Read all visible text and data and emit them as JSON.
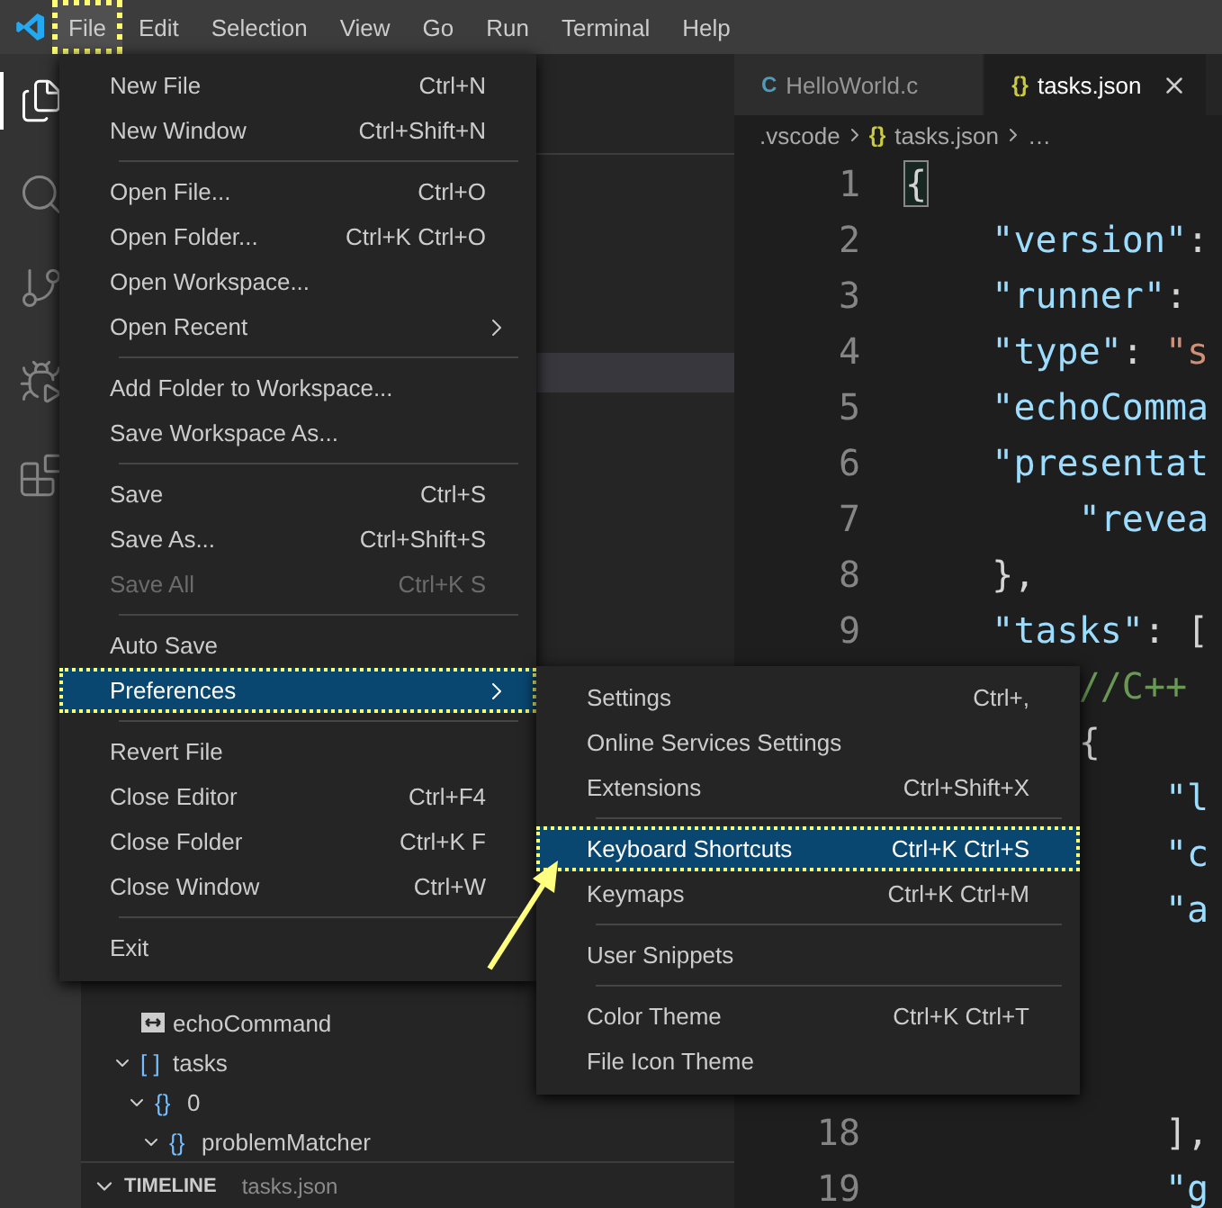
{
  "menubar": {
    "items": [
      {
        "label": "File",
        "selected": true
      },
      {
        "label": "Edit",
        "selected": false
      },
      {
        "label": "Selection",
        "selected": false
      },
      {
        "label": "View",
        "selected": false
      },
      {
        "label": "Go",
        "selected": false
      },
      {
        "label": "Run",
        "selected": false
      },
      {
        "label": "Terminal",
        "selected": false
      },
      {
        "label": "Help",
        "selected": false
      }
    ]
  },
  "activity_bar": [
    {
      "kind": "explorer",
      "selected": true
    },
    {
      "kind": "search",
      "selected": false
    },
    {
      "kind": "source-control",
      "selected": false
    },
    {
      "kind": "run",
      "selected": false
    },
    {
      "kind": "extensions",
      "selected": false
    }
  ],
  "sidebar": {
    "outline": [
      {
        "kind": "string",
        "label": "echoCommand"
      },
      {
        "kind": "array",
        "icon": "[ ]",
        "label": "tasks",
        "expanded": true,
        "children": [
          {
            "kind": "object",
            "icon": "{}",
            "label": "0",
            "expanded": true,
            "children": [
              {
                "kind": "object",
                "icon": "{}",
                "label": "problemMatcher",
                "expanded": true
              }
            ]
          }
        ]
      }
    ],
    "timeline": {
      "title": "TIMELINE",
      "file": "tasks.json",
      "expanded": true
    }
  },
  "editor": {
    "tabs": [
      {
        "icon": "C",
        "label": "HelloWorld.c",
        "selected": false
      },
      {
        "icon": "{}",
        "label": "tasks.json",
        "selected": true
      }
    ],
    "breadcrumb": [
      {
        "label": ".vscode"
      },
      {
        "icon": "{}",
        "label": "tasks.json"
      },
      {
        "label": "…"
      }
    ],
    "lines": [
      {
        "kind": "code",
        "number": "1",
        "tokens": [
          {
            "kind": "bracket-match",
            "text": "{"
          }
        ]
      },
      {
        "kind": "code",
        "number": "2",
        "tokens": [
          {
            "kind": "key",
            "text": "    \"version\""
          },
          {
            "kind": "punct",
            "text": ":"
          }
        ]
      },
      {
        "kind": "code",
        "number": "3",
        "tokens": [
          {
            "kind": "key",
            "text": "    \"runner\""
          },
          {
            "kind": "punct",
            "text": ":"
          }
        ]
      },
      {
        "kind": "code",
        "number": "4",
        "tokens": [
          {
            "kind": "key",
            "text": "    \"type\""
          },
          {
            "kind": "punct",
            "text": ": "
          },
          {
            "kind": "string",
            "text": "\"s"
          }
        ]
      },
      {
        "kind": "code",
        "number": "5",
        "tokens": [
          {
            "kind": "key",
            "text": "    \"echoComma"
          }
        ]
      },
      {
        "kind": "code",
        "number": "6",
        "tokens": [
          {
            "kind": "key",
            "text": "    \"presentat"
          }
        ]
      },
      {
        "kind": "code",
        "number": "7",
        "tokens": [
          {
            "kind": "key",
            "text": "        \"revea"
          }
        ]
      },
      {
        "kind": "code",
        "number": "8",
        "tokens": [
          {
            "kind": "punct",
            "text": "    },"
          }
        ]
      },
      {
        "kind": "code",
        "number": "9",
        "tokens": [
          {
            "kind": "key",
            "text": "    \"tasks\""
          },
          {
            "kind": "punct",
            "text": ": ["
          }
        ]
      },
      {
        "kind": "code",
        "tokens": [
          {
            "kind": "comment",
            "text": "        //C++"
          }
        ]
      },
      {
        "kind": "code",
        "tokens": [
          {
            "kind": "punct",
            "text": "        {"
          }
        ]
      },
      {
        "kind": "code",
        "tokens": [
          {
            "kind": "key",
            "text": "            \"l"
          }
        ]
      },
      {
        "kind": "code",
        "tokens": [
          {
            "kind": "key",
            "text": "            \"c"
          }
        ]
      },
      {
        "kind": "code",
        "tokens": [
          {
            "kind": "key",
            "text": "            \"a"
          }
        ]
      },
      {
        "kind": "blank"
      },
      {
        "kind": "blank"
      },
      {
        "kind": "blank"
      },
      {
        "kind": "code",
        "number": "18",
        "tokens": [
          {
            "kind": "punct",
            "text": "            ],"
          }
        ]
      },
      {
        "kind": "code",
        "number": "19",
        "tokens": [
          {
            "kind": "key",
            "text": "            \"g"
          }
        ]
      }
    ]
  },
  "file_menu": {
    "items": [
      {
        "kind": "item",
        "label": "New File",
        "shortcut": "Ctrl+N",
        "selected": false,
        "disabled": false
      },
      {
        "kind": "item",
        "label": "New Window",
        "shortcut": "Ctrl+Shift+N",
        "selected": false,
        "disabled": false
      },
      {
        "kind": "separator"
      },
      {
        "kind": "item",
        "label": "Open File...",
        "shortcut": "Ctrl+O",
        "selected": false,
        "disabled": false
      },
      {
        "kind": "item",
        "label": "Open Folder...",
        "shortcut": "Ctrl+K Ctrl+O",
        "selected": false,
        "disabled": false
      },
      {
        "kind": "item",
        "label": "Open Workspace...",
        "selected": false,
        "disabled": false
      },
      {
        "kind": "item",
        "label": "Open Recent",
        "submenu": true,
        "selected": false,
        "disabled": false
      },
      {
        "kind": "separator"
      },
      {
        "kind": "item",
        "label": "Add Folder to Workspace...",
        "selected": false,
        "disabled": false
      },
      {
        "kind": "item",
        "label": "Save Workspace As...",
        "selected": false,
        "disabled": false
      },
      {
        "kind": "separator"
      },
      {
        "kind": "item",
        "label": "Save",
        "shortcut": "Ctrl+S",
        "selected": false,
        "disabled": false
      },
      {
        "kind": "item",
        "label": "Save As...",
        "shortcut": "Ctrl+Shift+S",
        "selected": false,
        "disabled": false
      },
      {
        "kind": "item",
        "label": "Save All",
        "shortcut": "Ctrl+K S",
        "selected": false,
        "disabled": true
      },
      {
        "kind": "separator"
      },
      {
        "kind": "item",
        "label": "Auto Save",
        "selected": false,
        "disabled": false
      },
      {
        "kind": "item",
        "label": "Preferences",
        "submenu": true,
        "selected": true,
        "disabled": false
      },
      {
        "kind": "separator"
      },
      {
        "kind": "item",
        "label": "Revert File",
        "selected": false,
        "disabled": false
      },
      {
        "kind": "item",
        "label": "Close Editor",
        "shortcut": "Ctrl+F4",
        "selected": false,
        "disabled": false
      },
      {
        "kind": "item",
        "label": "Close Folder",
        "shortcut": "Ctrl+K F",
        "selected": false,
        "disabled": false
      },
      {
        "kind": "item",
        "label": "Close Window",
        "shortcut": "Ctrl+W",
        "selected": false,
        "disabled": false
      },
      {
        "kind": "separator"
      },
      {
        "kind": "item",
        "label": "Exit",
        "selected": false,
        "disabled": false
      }
    ]
  },
  "submenu": {
    "items": [
      {
        "kind": "item",
        "label": "Settings",
        "shortcut": "Ctrl+,",
        "selected": false,
        "disabled": false
      },
      {
        "kind": "item",
        "label": "Online Services Settings",
        "selected": false,
        "disabled": false
      },
      {
        "kind": "item",
        "label": "Extensions",
        "shortcut": "Ctrl+Shift+X",
        "selected": false,
        "disabled": false
      },
      {
        "kind": "separator"
      },
      {
        "kind": "item",
        "label": "Keyboard Shortcuts",
        "shortcut": "Ctrl+K Ctrl+S",
        "selected": true,
        "disabled": false
      },
      {
        "kind": "item",
        "label": "Keymaps",
        "shortcut": "Ctrl+K Ctrl+M",
        "selected": false,
        "disabled": false
      },
      {
        "kind": "separator"
      },
      {
        "kind": "item",
        "label": "User Snippets",
        "selected": false,
        "disabled": false
      },
      {
        "kind": "separator"
      },
      {
        "kind": "item",
        "label": "Color Theme",
        "shortcut": "Ctrl+K Ctrl+T",
        "selected": false,
        "disabled": false
      },
      {
        "kind": "item",
        "label": "File Icon Theme",
        "selected": false,
        "disabled": false
      }
    ]
  }
}
